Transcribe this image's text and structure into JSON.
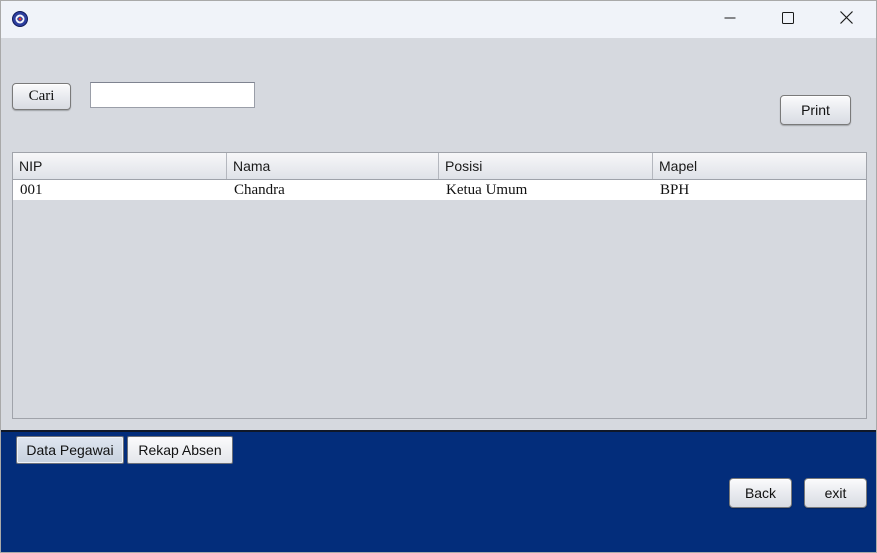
{
  "window": {
    "icon": "java-app-icon",
    "controls": {
      "minimize": "minimize-icon",
      "maximize": "maximize-icon",
      "close": "close-icon"
    }
  },
  "toolbar": {
    "search_button_label": "Cari",
    "search_value": "",
    "print_button_label": "Print"
  },
  "table": {
    "columns": [
      "NIP",
      "Nama",
      "Posisi",
      "Mapel"
    ],
    "rows": [
      [
        "001",
        "Chandra",
        "Ketua Umum",
        "BPH"
      ]
    ]
  },
  "tabs": [
    {
      "label": "Data Pegawai",
      "selected": true
    },
    {
      "label": "Rekap Absen",
      "selected": false
    }
  ],
  "footer": {
    "back_label": "Back",
    "exit_label": "exit"
  },
  "colors": {
    "panel": "#d6d9df",
    "bottom_bar": "#032d7b",
    "titlebar": "#f0f3f9"
  }
}
